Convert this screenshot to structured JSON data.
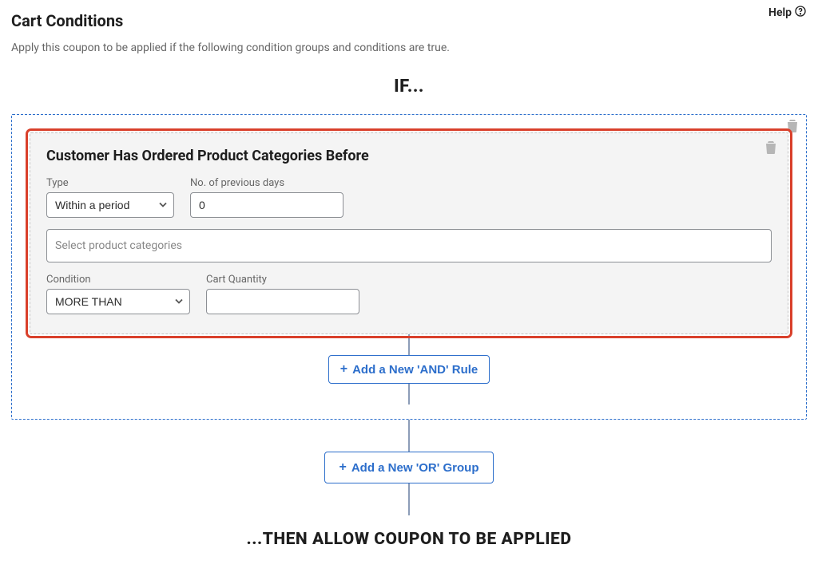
{
  "help": {
    "label": "Help"
  },
  "header": {
    "title": "Cart Conditions",
    "subtitle": "Apply this coupon to be applied if the following condition groups and conditions are true."
  },
  "if_label": "IF...",
  "group": {
    "rule": {
      "title": "Customer Has Ordered Product Categories Before",
      "type_label": "Type",
      "type_value": "Within a period",
      "days_label": "No. of previous days",
      "days_value": "0",
      "categories_placeholder": "Select product categories",
      "condition_label": "Condition",
      "condition_value": "MORE THAN",
      "qty_label": "Cart Quantity",
      "qty_value": ""
    },
    "add_and_label": "Add a New 'AND' Rule"
  },
  "add_or_label": "Add a New 'OR' Group",
  "then_label": "...THEN ALLOW COUPON TO BE APPLIED"
}
